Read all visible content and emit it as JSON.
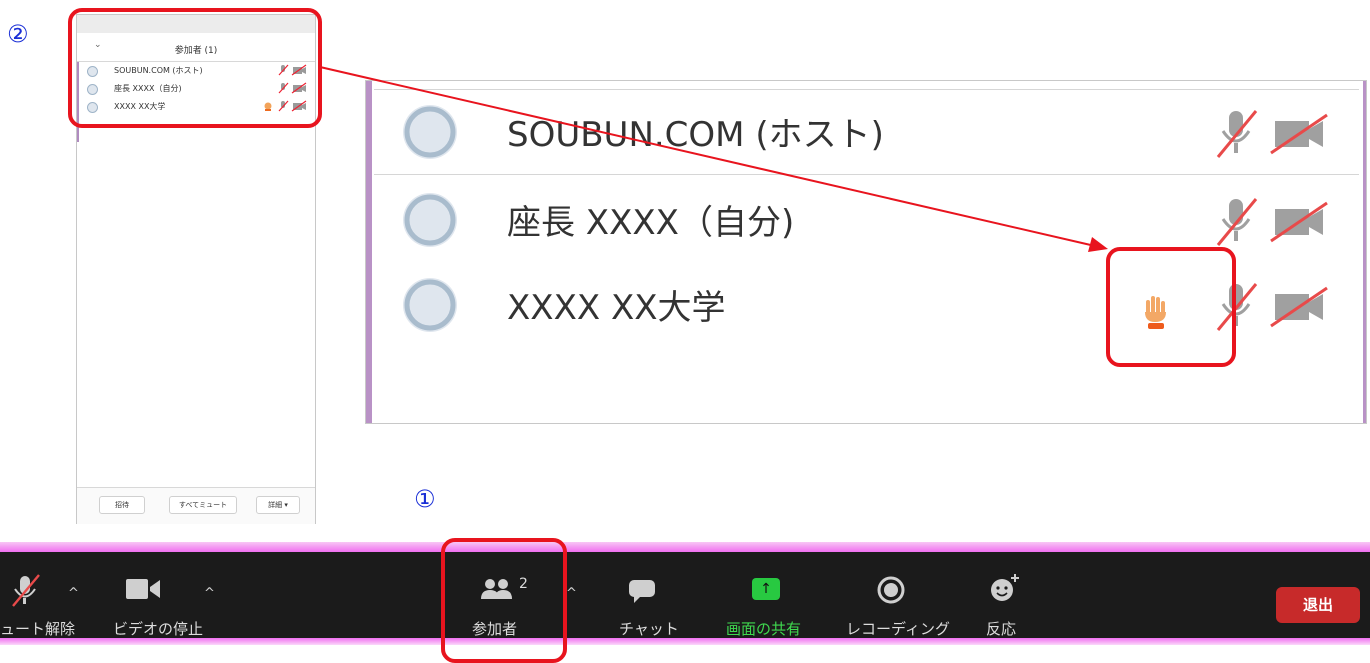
{
  "annotations": {
    "step1": "①",
    "step2": "②"
  },
  "panel": {
    "title": "参加者 (1)",
    "participants": [
      {
        "name": "SOUBUN.COM (ホスト)",
        "hand_raised": false
      },
      {
        "name": "座長 XXXX（自分)",
        "hand_raised": false
      },
      {
        "name": "XXXX XX大学",
        "hand_raised": true
      }
    ],
    "footer": {
      "invite": "招待",
      "mute_all": "すべてミュート",
      "more": "詳細 ▾"
    }
  },
  "zoomed": {
    "participants": [
      {
        "name": "SOUBUN.COM (ホスト)",
        "hand_raised": false
      },
      {
        "name": "座長 XXXX（自分)",
        "hand_raised": false
      },
      {
        "name": "XXXX  XX大学",
        "hand_raised": true
      }
    ]
  },
  "toolbar": {
    "mute_label": "ュート解除",
    "video_label": "ビデオの停止",
    "participants_label": "参加者",
    "participants_count": "2",
    "chat_label": "チャット",
    "share_label": "画面の共有",
    "record_label": "レコーディング",
    "reactions_label": "反応",
    "leave_label": "退出",
    "share_color": "#28c941",
    "leave_color": "#c72a2a"
  },
  "icons": [
    "chevron-down-icon",
    "avatar-icon",
    "mic-muted-icon",
    "video-off-icon",
    "raised-hand-icon",
    "participants-icon",
    "chat-icon",
    "share-screen-icon",
    "record-icon",
    "reaction-icon",
    "caret-up-icon"
  ]
}
